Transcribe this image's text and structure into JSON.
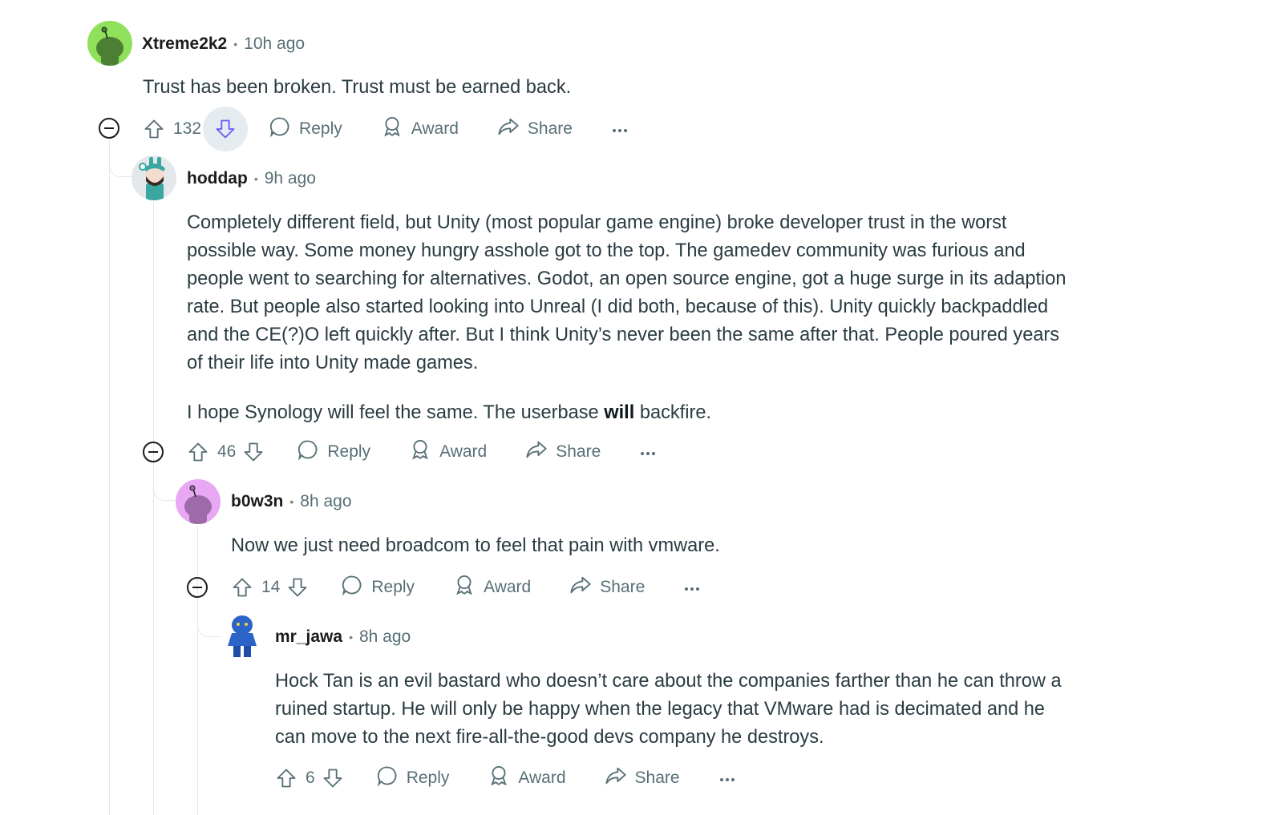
{
  "comments": [
    {
      "username": "Xtreme2k2",
      "time": "10h ago",
      "text": [
        "Trust has been broken. Trust must be earned back."
      ],
      "votes": "132",
      "reply_label": "Reply",
      "award_label": "Award",
      "share_label": "Share",
      "avatar_color": "#8fe05b"
    },
    {
      "username": "hoddap",
      "time": "9h ago",
      "text": [
        "Completely different field, but Unity (most popular game engine) broke developer trust in the worst",
        "possible way. Some money hungry asshole got to the top. The gamedev community was furious and",
        "people went to searching for alternatives. Godot, an open source engine, got a huge surge in its adaption",
        "rate. But people also started looking into Unreal (I did both, because of this). Unity quickly backpaddled",
        "and the CE(?)O left quickly after. But I think Unity’s never been the same after that. People poured years",
        "of their life into Unity made games."
      ],
      "text2_before": "I hope Synology will feel the same. The userbase ",
      "text2_bold": "will",
      "text2_after": " backfire.",
      "votes": "46",
      "reply_label": "Reply",
      "award_label": "Award",
      "share_label": "Share"
    },
    {
      "username": "b0w3n",
      "time": "8h ago",
      "text": [
        "Now we just need broadcom to feel that pain with vmware."
      ],
      "votes": "14",
      "reply_label": "Reply",
      "award_label": "Award",
      "share_label": "Share",
      "avatar_color": "#e9a8f4"
    },
    {
      "username": "mr_jawa",
      "time": "8h ago",
      "text": [
        "Hock Tan is an evil bastard who doesn’t care about the companies farther than he can throw a",
        "ruined startup. He will only be happy when the legacy that VMware had is decimated and he",
        "can move to the next fire-all-the-good devs company he destroys."
      ],
      "votes": "6",
      "reply_label": "Reply",
      "award_label": "Award",
      "share_label": "Share"
    }
  ],
  "icons": {
    "upvote": "upvote-icon",
    "downvote": "downvote-icon",
    "reply": "comment-bubble-icon",
    "award": "award-ribbon-icon",
    "share": "share-arrow-icon",
    "more": "more-dots-icon",
    "collapse": "collapse-minus-icon"
  },
  "colors": {
    "downvote_active": "#6a5cff",
    "text_secondary": "#576f76",
    "thread_line": "#e5e7ea"
  }
}
